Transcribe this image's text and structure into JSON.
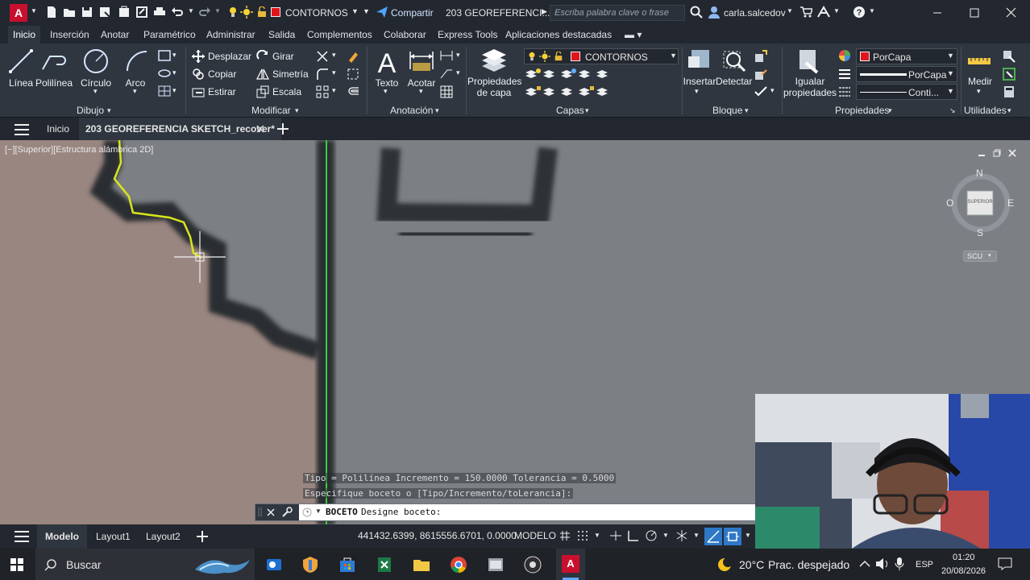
{
  "title_bar": {
    "app_logo": "A",
    "current_layer": "CONTORNOS",
    "share_label": "Compartir",
    "doc_title": "203 GEOREFERENCI...",
    "search_placeholder": "Escriba palabra clave o frase",
    "user": "carla.salcedov"
  },
  "ribbon_tabs": [
    "Inicio",
    "Inserción",
    "Anotar",
    "Paramétrico",
    "Administrar",
    "Salida",
    "Complementos",
    "Colaborar",
    "Express Tools",
    "Aplicaciones destacadas"
  ],
  "ribbon": {
    "draw": {
      "title": "Dibujo",
      "items": [
        "Línea",
        "Polilínea",
        "Círculo",
        "Arco"
      ]
    },
    "modify": {
      "title": "Modificar",
      "items": [
        "Desplazar",
        "Girar",
        "Copiar",
        "Simetría",
        "Estirar",
        "Escala"
      ]
    },
    "annotation": {
      "title": "Anotación",
      "items": [
        "Texto",
        "Acotar"
      ]
    },
    "layers": {
      "title": "Capas",
      "props_line1": "Propiedades",
      "props_line2": "de capa",
      "layer_name": "CONTORNOS"
    },
    "block": {
      "title": "Bloque",
      "items": [
        "Insertar",
        "Detectar"
      ]
    },
    "properties": {
      "title": "Propiedades",
      "match_line1": "Igualar",
      "match_line2": "propiedades",
      "color": "PorCapa",
      "lineweight": "PorCapa",
      "linetype": "Conti..."
    },
    "utilities": {
      "title": "Utilidades",
      "measure": "Medir"
    }
  },
  "file_tabs": {
    "start": "Inicio",
    "document": "203 GEOREFERENCIA SKETCH_recover*"
  },
  "viewport": {
    "label": "[−][Superior][Estructura alámbrica 2D]",
    "viewcube": {
      "n": "N",
      "s": "S",
      "e": "E",
      "w": "O",
      "face": "SUPERIOR",
      "ucs": "SCU"
    }
  },
  "command": {
    "history": [
      "Tipo = Polilínea Incremento = 150.0000 Tolerancia = 0.5000",
      "Especifique boceto o [Tipo/Incremento/toLerancia]:"
    ],
    "prompt_cmd": "BOCETO",
    "prompt_text": "Designe boceto:"
  },
  "layout_tabs": [
    "Modelo",
    "Layout1",
    "Layout2"
  ],
  "status": {
    "coords": "441432.6399, 8615556.6701, 0.0000",
    "mode": "MODELO"
  },
  "taskbar": {
    "search": "Buscar",
    "weather_temp": "20°C",
    "weather_text": "Prac. despejado",
    "lang": "ESP",
    "time": "01:20",
    "date": "20/08/2026"
  },
  "colors": {
    "layer": "#e0151b",
    "accent_green": "#35d13a",
    "sketch_yellow": "#d8e61a",
    "autocad_red": "#c8102e"
  }
}
